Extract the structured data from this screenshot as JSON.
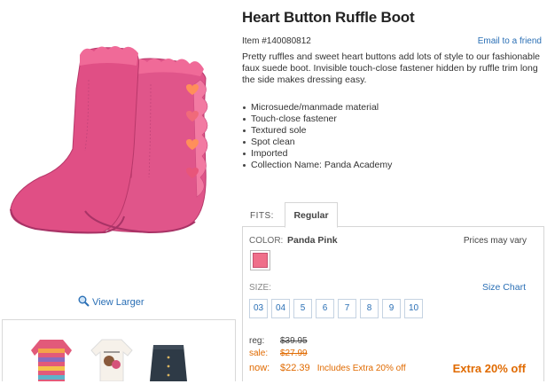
{
  "product": {
    "title": "Heart Button Ruffle Boot",
    "item_number": "Item #140080812",
    "email_link": "Email to a friend",
    "description": "Pretty ruffles and sweet heart buttons add lots of style to our fashionable faux suede boot. Invisible touch-close fastener hidden by ruffle trim long the side makes dressing easy.",
    "features": [
      "Microsuede/manmade material",
      "Touch-close fastener",
      "Textured sole",
      "Spot clean",
      "Imported",
      "Collection Name: Panda Academy"
    ]
  },
  "gallery": {
    "view_larger": "View Larger",
    "zoom_icon": "magnifier-icon",
    "thumbnails": [
      "striped-sweater",
      "white-tee",
      "denim-skirt"
    ]
  },
  "fits": {
    "label": "FITS:",
    "active_tab": "Regular"
  },
  "color": {
    "label": "COLOR:",
    "selected": "Panda Pink",
    "prices_note": "Prices may vary",
    "swatch_color": "#ef6f8a"
  },
  "size": {
    "label": "SIZE:",
    "chart_link": "Size Chart",
    "options": [
      "03",
      "04",
      "5",
      "6",
      "7",
      "8",
      "9",
      "10"
    ]
  },
  "pricing": {
    "reg_label": "reg:",
    "reg_value": "$39.95",
    "sale_label": "sale:",
    "sale_value": "$27.99",
    "now_label": "now:",
    "now_value": "$22.39",
    "now_note": "Includes Extra 20% off",
    "promo": "Extra 20% off"
  },
  "colors": {
    "link": "#2a6fb5",
    "accent_orange": "#e06a00",
    "boot_pink": "#e85a8a"
  }
}
